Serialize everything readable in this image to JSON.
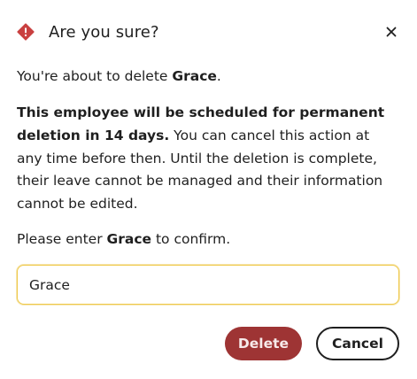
{
  "dialog": {
    "title": "Are you sure?",
    "intro_prefix": "You're about to delete ",
    "employee_name": "Grace",
    "intro_suffix": ".",
    "warning_bold": "This employee will be scheduled for permanent deletion in 14 days.",
    "warning_rest": " You can cancel this action at any time before then. Until the deletion is complete, their leave cannot be managed and their information cannot be edited.",
    "confirm_prefix": "Please enter ",
    "confirm_suffix": " to confirm.",
    "input_value": "Grace",
    "delete_label": "Delete",
    "cancel_label": "Cancel"
  },
  "icons": {
    "warning": "warning-diamond-icon",
    "close": "close-icon"
  },
  "colors": {
    "warning_icon": "#c94040",
    "delete_button": "#9e3434",
    "input_focus_border": "#efc94a",
    "text": "#1f1f1f"
  }
}
